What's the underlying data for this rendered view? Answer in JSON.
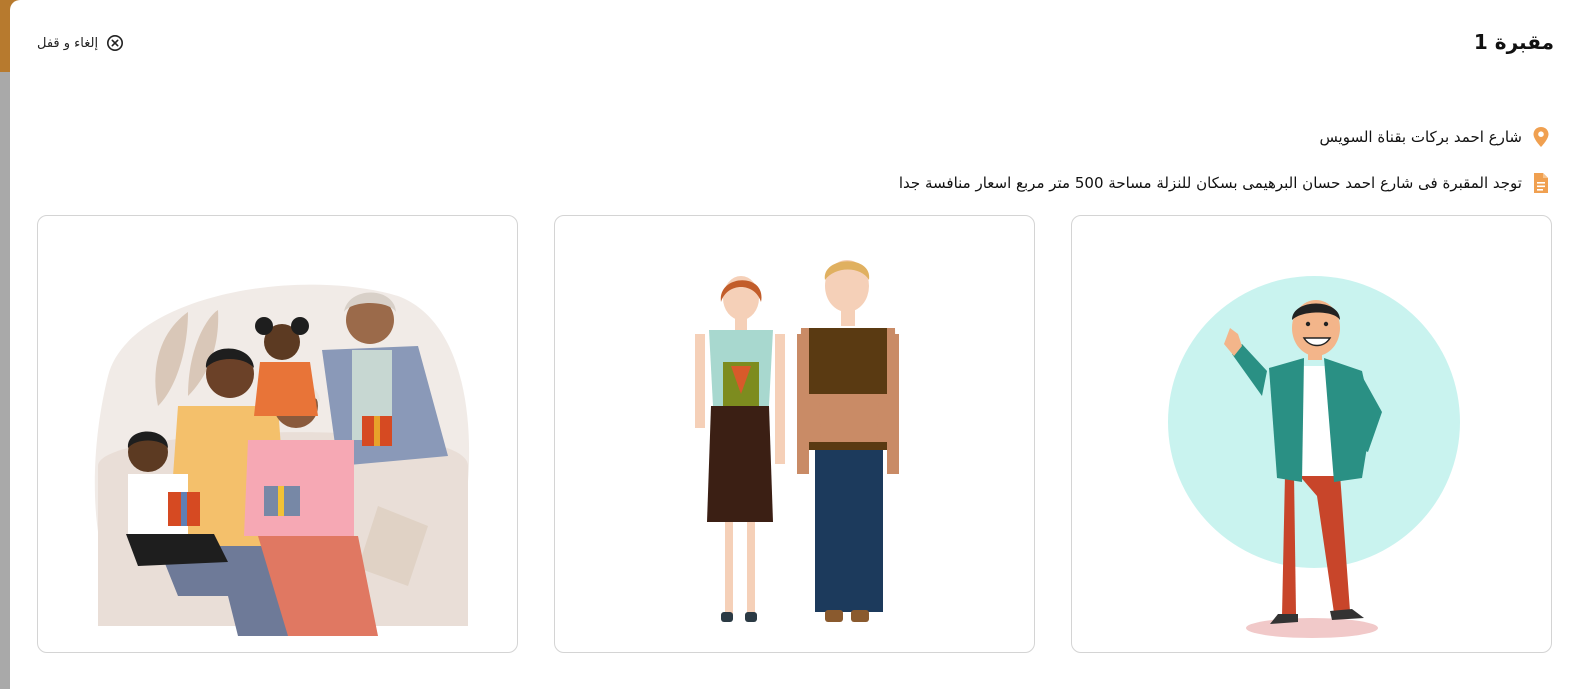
{
  "modal": {
    "title": "مقبرة 1",
    "close_label": "إلغاء و قفل",
    "location": "شارع احمد بركات بقناة السويس",
    "description": "توجد المقبرة فى شارع احمد حسان البرهيمى بسكان للنزلة مساحة 500 متر مربع اسعار منافسة جدا"
  },
  "icons": {
    "close": "close-circle-icon",
    "location": "map-pin-icon",
    "description": "document-icon"
  },
  "gallery": {
    "images": [
      {
        "name": "waving-man-image"
      },
      {
        "name": "woman-and-man-image"
      },
      {
        "name": "family-gifts-image"
      }
    ]
  },
  "colors": {
    "accent": "#f0a050",
    "text": "#111111",
    "card_border": "#d4d4d4"
  }
}
